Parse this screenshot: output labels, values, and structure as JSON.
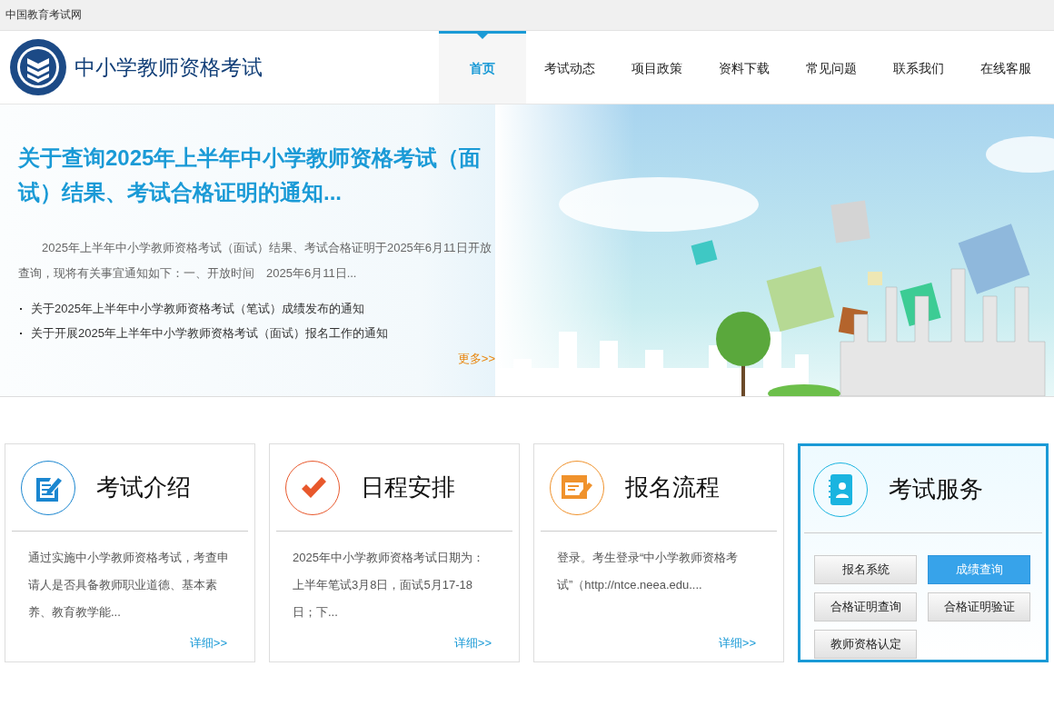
{
  "top_bar": {
    "site_name": "中国教育考试网"
  },
  "header": {
    "title": "中小学教师资格考试",
    "nav": [
      {
        "label": "首页",
        "selected": true
      },
      {
        "label": "考试动态",
        "selected": false
      },
      {
        "label": "项目政策",
        "selected": false
      },
      {
        "label": "资料下载",
        "selected": false
      },
      {
        "label": "常见问题",
        "selected": false
      },
      {
        "label": "联系我们",
        "selected": false
      },
      {
        "label": "在线客服",
        "selected": false
      }
    ]
  },
  "banner": {
    "headline": "关于查询2025年上半年中小学教师资格考试（面试）结果、考试合格证明的通知...",
    "summary": "2025年上半年中小学教师资格考试（面试）结果、考试合格证明于2025年6月11日开放查询，现将有关事宜通知如下：一、开放时间　2025年6月11日...",
    "news": [
      "关于2025年上半年中小学教师资格考试（笔试）成绩发布的通知",
      "关于开展2025年上半年中小学教师资格考试（面试）报名工作的通知"
    ],
    "more": "更多>>"
  },
  "cards": [
    {
      "kind": "document",
      "color": "#1a86d0",
      "title": "考试介绍",
      "selected": false,
      "text": "通过实施中小学教师资格考试，考查申请人是否具备教师职业道德、基本素养、教育教学能...",
      "link": "详细>>"
    },
    {
      "kind": "check",
      "color": "#e8582c",
      "title": "日程安排",
      "selected": false,
      "text": "2025年中小学教师资格考试日期为：上半年笔试3月8日，面试5月17-18日；下...",
      "link": "详细>>"
    },
    {
      "kind": "form",
      "color": "#f0922c",
      "title": "报名流程",
      "selected": false,
      "text": "登录。考生登录“中小学教师资格考试”（http://ntce.neea.edu....",
      "link": "详细>>"
    },
    {
      "kind": "contacts",
      "color": "#1ab4e0",
      "title": "考试服务",
      "selected": true,
      "buttons": [
        {
          "label": "报名系统",
          "selected": false
        },
        {
          "label": "成绩查询",
          "selected": true
        },
        {
          "label": "合格证明查询",
          "selected": false
        },
        {
          "label": "合格证明验证",
          "selected": false
        },
        {
          "label": "教师资格认定",
          "selected": false
        }
      ]
    }
  ]
}
